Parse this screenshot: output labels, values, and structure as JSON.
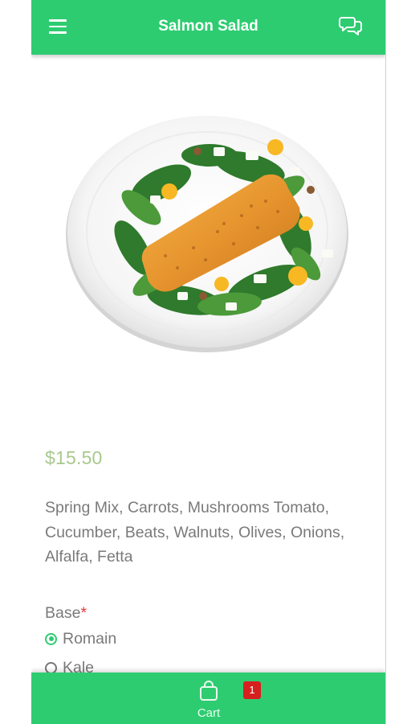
{
  "header": {
    "title": "Salmon Salad",
    "menu_icon": "menu-icon",
    "chat_icon": "chat-bubbles-icon"
  },
  "product": {
    "image": "salmon-salad-plate-photo",
    "price": "$15.50",
    "description": "Spring Mix, Carrots, Mushrooms Tomato, Cucumber, Beats, Walnuts, Olives, Onions, Alfalfa, Fetta"
  },
  "options": {
    "base_label": "Base",
    "required_mark": "*",
    "choices": [
      {
        "label": "Romain",
        "selected": true
      },
      {
        "label": "Kale",
        "selected": false
      }
    ]
  },
  "cart": {
    "label": "Cart",
    "count": "1",
    "icon": "shopping-bag-icon"
  },
  "colors": {
    "primary": "#2ecc71",
    "price": "#a8c98d",
    "badge": "#d61f1f",
    "required": "#e23b3b"
  }
}
